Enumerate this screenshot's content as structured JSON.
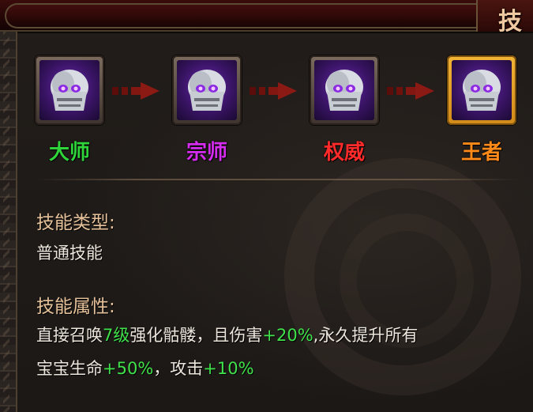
{
  "window": {
    "title": "技"
  },
  "tiers": [
    {
      "label": "大师",
      "color": "#2ed43a",
      "selected": false
    },
    {
      "label": "宗师",
      "color": "#d62cf0",
      "selected": false
    },
    {
      "label": "权威",
      "color": "#ff2a2a",
      "selected": false
    },
    {
      "label": "王者",
      "color": "#ff8a1a",
      "selected": true
    }
  ],
  "skill_type": {
    "heading": "技能类型:",
    "value": "普通技能"
  },
  "skill_attr": {
    "heading": "技能属性:",
    "line1": {
      "p1": "直接召唤",
      "level": "7级",
      "p2": "强化骷髅，且伤害",
      "damage": "+20%",
      "p3": ",永久提升所有"
    },
    "line2": {
      "p1": "宝宝生命",
      "life": "+50%",
      "p2": "，攻击",
      "attack": "+10%"
    }
  },
  "colors": {
    "highlight_green": "#3fe24a",
    "heading": "#e6c29a",
    "body": "#ece6dd",
    "selected_frame": "#f1b536"
  },
  "icons": {
    "skill_icon": "skull-helmet-icon",
    "arrow": "arrow-right-icon"
  }
}
